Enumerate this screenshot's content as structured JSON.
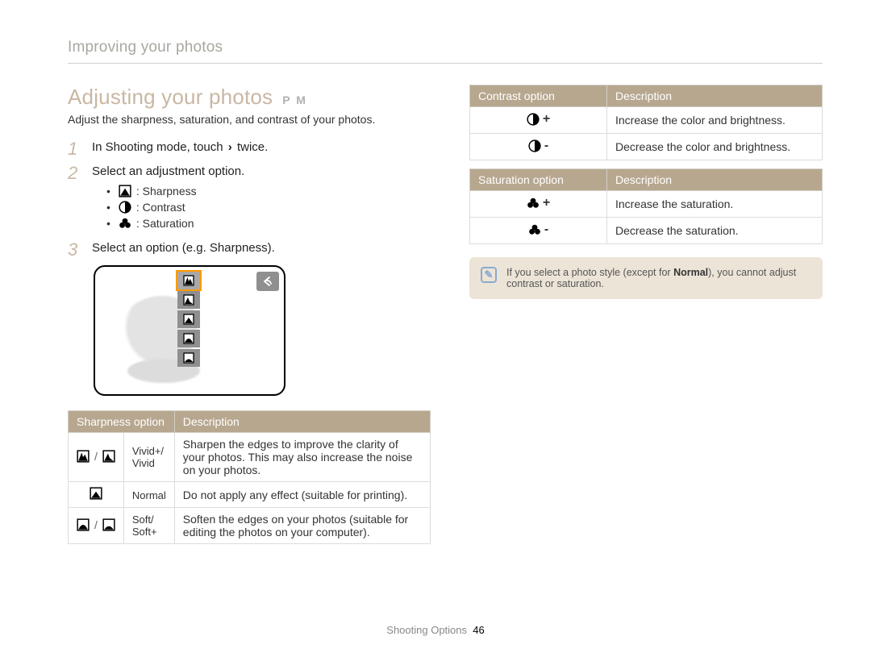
{
  "breadcrumb": "Improving your photos",
  "title": "Adjusting your photos",
  "modes": "P M",
  "subhead": "Adjust the sharpness, saturation, and contrast of your photos.",
  "steps": [
    {
      "num": "1",
      "text_pre": "In Shooting mode, touch ",
      "chevron": "›",
      "text_post": " twice."
    },
    {
      "num": "2",
      "text": "Select an adjustment option.",
      "bullets": [
        {
          "icon": "sharpness",
          "label": ": Sharpness"
        },
        {
          "icon": "contrast",
          "label": ": Contrast"
        },
        {
          "icon": "saturation",
          "label": ": Saturation"
        }
      ]
    },
    {
      "num": "3",
      "text": "Select an option (e.g. Sharpness)."
    }
  ],
  "sharpness_table": {
    "headers": [
      "Sharpness option",
      "Description"
    ],
    "rows": [
      {
        "icons": [
          "sharp-vivid2",
          "sharp-vivid1"
        ],
        "label": "Vivid+/\nVivid",
        "desc": "Sharpen the edges to improve the clarity of your photos. This may also increase the noise on your photos."
      },
      {
        "icons": [
          "sharp-normal"
        ],
        "label": "Normal",
        "desc": "Do not apply any effect (suitable for printing)."
      },
      {
        "icons": [
          "sharp-soft1",
          "sharp-soft2"
        ],
        "label": "Soft/\nSoft+",
        "desc": "Soften the edges on your photos (suitable for editing the photos on your computer)."
      }
    ]
  },
  "contrast_table": {
    "headers": [
      "Contrast option",
      "Description"
    ],
    "rows": [
      {
        "icon": "contrast",
        "sign": "+",
        "desc": "Increase the color and brightness."
      },
      {
        "icon": "contrast",
        "sign": "-",
        "desc": "Decrease the color and brightness."
      }
    ]
  },
  "saturation_table": {
    "headers": [
      "Saturation option",
      "Description"
    ],
    "rows": [
      {
        "icon": "saturation",
        "sign": "+",
        "desc": "Increase the saturation."
      },
      {
        "icon": "saturation",
        "sign": "-",
        "desc": "Decrease the saturation."
      }
    ]
  },
  "note": {
    "text_pre": "If you select a photo style (except for ",
    "bold": "Normal",
    "text_post": "), you cannot adjust contrast or saturation."
  },
  "footer": {
    "section": "Shooting Options",
    "page": "46"
  }
}
